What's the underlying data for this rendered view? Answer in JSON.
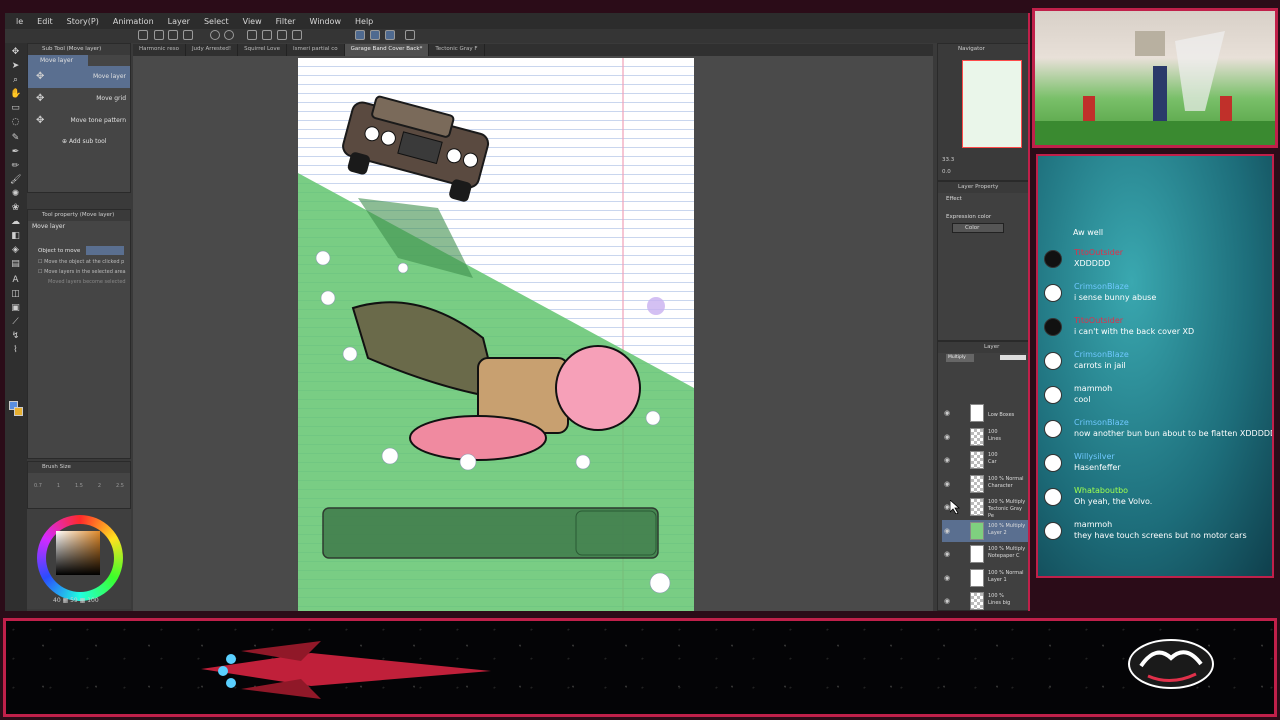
{
  "app": {
    "menu": [
      "le",
      "Edit",
      "Story(P)",
      "Animation",
      "Layer",
      "Select",
      "View",
      "Filter",
      "Window",
      "Help"
    ],
    "file_tabs": [
      {
        "label": "Harmonic reso",
        "active": false
      },
      {
        "label": "Judy Arrested!",
        "active": false
      },
      {
        "label": "Squirrel Love",
        "active": false
      },
      {
        "label": "Ismeri partial co",
        "active": false
      },
      {
        "label": "Garage Band Cover Back*",
        "active": true
      },
      {
        "label": "Tectonic Gray F",
        "active": false
      }
    ],
    "subtool": {
      "title": "Sub Tool (Move layer)",
      "tab": "Move layer",
      "items": [
        "Move layer",
        "Move grid",
        "Move tone pattern"
      ],
      "add_label": "Add sub tool"
    },
    "tool_property": {
      "title": "Tool property (Move layer)",
      "tool_name": "Move layer",
      "object_label": "Object to move",
      "options": [
        "Move the object at the clicked p",
        "Move layers in the selected area",
        "Moved layers become selected"
      ]
    },
    "brush_size": {
      "title": "Brush Size",
      "sizes": [
        "0.7",
        "1",
        "1.5",
        "2",
        "2.5"
      ]
    },
    "status": {
      "zoom_readout": "40 ▦ 59 ▦ 100"
    },
    "navigator": {
      "title": "Navigator",
      "zoom": "33.3",
      "angle": "0.0"
    },
    "layer_property": {
      "title": "Layer Property",
      "effect_label": "Effect",
      "expression_label": "Expression color",
      "expression_value": "Color"
    },
    "layers": {
      "title": "Layer",
      "blend": "Multiply",
      "items": [
        {
          "opacity": "",
          "name": "Low Boxes",
          "thumb": "white",
          "selected": false
        },
        {
          "opacity": "100",
          "name": "Lines",
          "thumb": "check",
          "selected": false
        },
        {
          "opacity": "100",
          "name": "Car",
          "thumb": "check",
          "selected": false
        },
        {
          "opacity": "100 % Normal",
          "name": "Character",
          "thumb": "check",
          "selected": false
        },
        {
          "opacity": "100 % Multiply",
          "name": "Tectonic Gray Pe",
          "thumb": "check",
          "selected": false
        },
        {
          "opacity": "100 % Multiply",
          "name": "Layer 2",
          "thumb": "green",
          "selected": true
        },
        {
          "opacity": "100 % Multiply",
          "name": "Notepaper C",
          "thumb": "white",
          "selected": false
        },
        {
          "opacity": "100 % Normal",
          "name": "Layer 1",
          "thumb": "white",
          "selected": false
        },
        {
          "opacity": "100 %",
          "name": "Lines big",
          "thumb": "check",
          "selected": false
        },
        {
          "opacity": "",
          "name": "Paper",
          "thumb": "white",
          "selected": false
        }
      ]
    }
  },
  "chat": {
    "header_message": "Aw well",
    "messages": [
      {
        "user": "TitoOutsider",
        "text": "XDDDDD",
        "user_color": "#e0304a",
        "avatar": "dark"
      },
      {
        "user": "CrimsonBlaze",
        "text": "i sense bunny abuse",
        "user_color": "#6fc8ff",
        "avatar": "light"
      },
      {
        "user": "TitoOutsider",
        "text": "i can't with the back cover XD",
        "user_color": "#e0304a",
        "avatar": "dark"
      },
      {
        "user": "CrimsonBlaze",
        "text": "carrots in jail",
        "user_color": "#6fc8ff",
        "avatar": "light"
      },
      {
        "user": "mammoh",
        "text": "cool",
        "user_color": "#ffffff",
        "avatar": "light"
      },
      {
        "user": "CrimsonBlaze",
        "text": "now another bun bun about to be flatten XDDDDD",
        "user_color": "#6fc8ff",
        "avatar": "light"
      },
      {
        "user": "Willysilver",
        "text": "Hasenfeffer",
        "user_color": "#6fc8ff",
        "avatar": "light"
      },
      {
        "user": "Whataboutbo",
        "text": "Oh yeah, the Volvo.",
        "user_color": "#a0ff50",
        "avatar": "light"
      },
      {
        "user": "mammoh",
        "text": "they have touch screens but no motor cars",
        "user_color": "#ffffff",
        "avatar": "light"
      }
    ]
  },
  "colors": {
    "frame": "#c0204a",
    "selection": "#5a6f90",
    "grass": "#5fc76a"
  }
}
